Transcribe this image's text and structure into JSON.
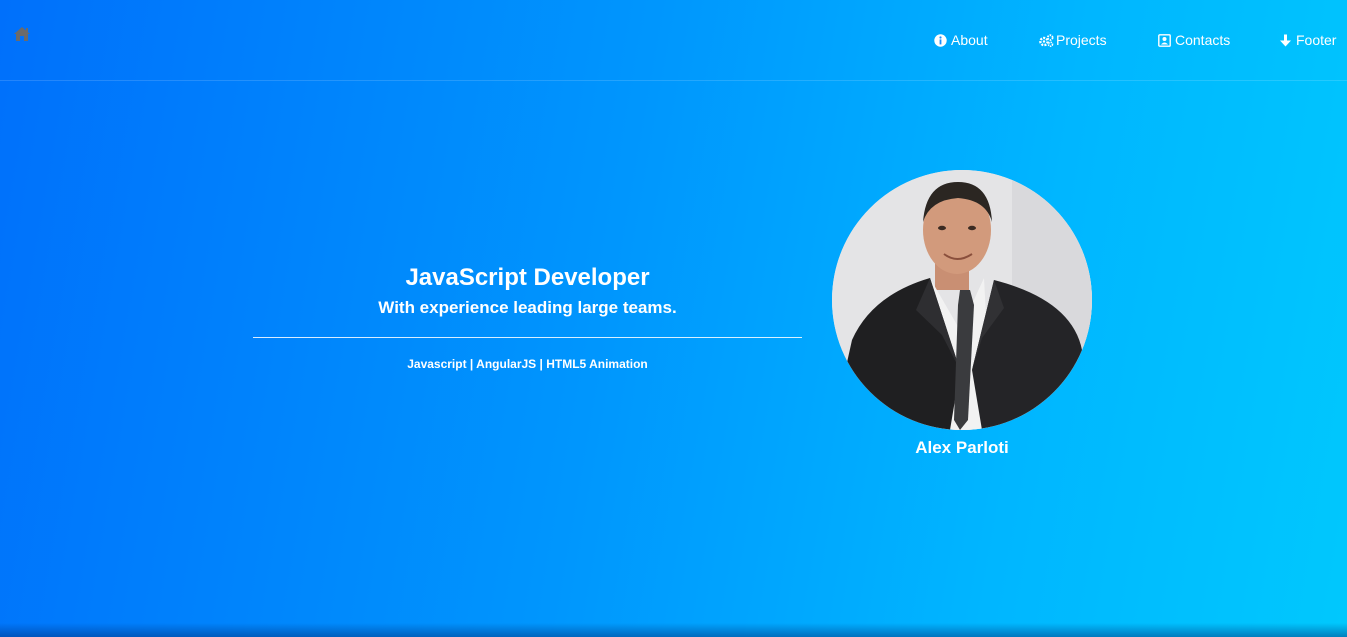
{
  "nav": {
    "home_icon": "home-icon",
    "items": [
      {
        "label": "About",
        "icon": "info-circle-icon"
      },
      {
        "label": "Projects",
        "icon": "gears-icon"
      },
      {
        "label": "Contacts",
        "icon": "address-book-icon"
      },
      {
        "label": "Footer",
        "icon": "arrow-down-icon"
      }
    ]
  },
  "hero": {
    "title": "JavaScript Developer",
    "subtitle": "With experience leading large teams.",
    "skills": "Javascript | AngularJS | HTML5 Animation"
  },
  "profile": {
    "name": "Alex Parloti"
  },
  "colors": {
    "gradient_start": "#0070fb",
    "gradient_end": "#00c8fd",
    "text": "#ffffff",
    "home_icon": "#6b6b6b"
  }
}
